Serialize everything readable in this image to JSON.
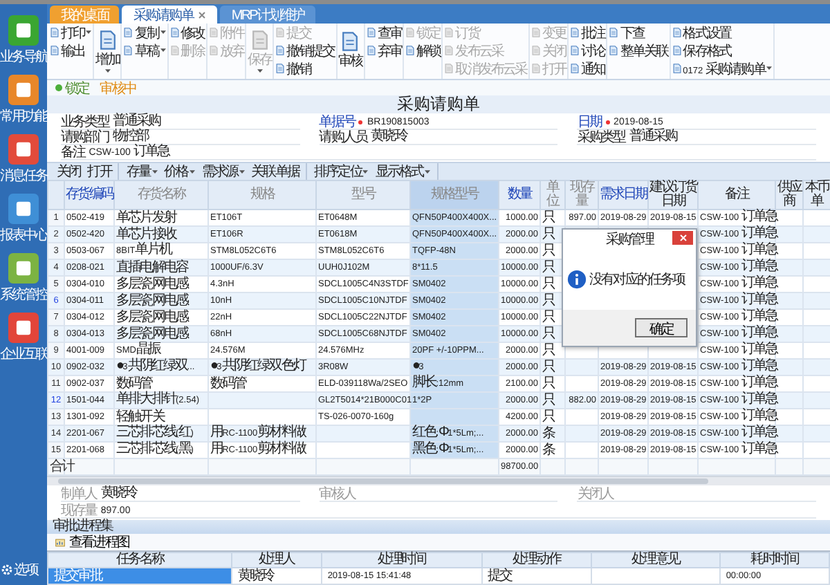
{
  "sidebar": {
    "items": [
      {
        "label": "业务导航",
        "color": "#3aa632"
      },
      {
        "label": "常用功能",
        "color": "#e8872a"
      },
      {
        "label": "消息任务",
        "color": "#e24b3b"
      },
      {
        "label": "报表中心",
        "color": "#3f8fd6"
      },
      {
        "label": "系统管控",
        "color": "#7cb342"
      },
      {
        "label": "企业互联",
        "color": "#e2453a"
      }
    ],
    "options": "选项"
  },
  "tabs": [
    {
      "label": "我的桌面",
      "selected": false,
      "kind": "home",
      "closable": false
    },
    {
      "label": "采购请购单",
      "selected": true,
      "kind": "doc",
      "closable": true
    },
    {
      "label": "MRP计划维护",
      "selected": false,
      "kind": "doc",
      "closable": false
    }
  ],
  "ribbon": [
    {
      "items": [
        {
          "label": "打印",
          "kind": "small",
          "dropdown": true,
          "disabled": false
        },
        {
          "label": "输出",
          "kind": "small",
          "dropdown": false,
          "disabled": false
        }
      ]
    },
    {
      "items": [
        {
          "label": "增加",
          "kind": "large",
          "dropdown": true,
          "disabled": false
        }
      ]
    },
    {
      "items": [
        {
          "label": "复制",
          "kind": "small",
          "dropdown": true,
          "disabled": false
        },
        {
          "label": "草稿",
          "kind": "small",
          "dropdown": true,
          "disabled": false
        }
      ]
    },
    {
      "items": [
        {
          "label": "修改",
          "kind": "small",
          "dropdown": false,
          "disabled": false
        },
        {
          "label": "删除",
          "kind": "small",
          "dropdown": false,
          "disabled": true
        }
      ]
    },
    {
      "items": [
        {
          "label": "附件",
          "kind": "small",
          "dropdown": false,
          "disabled": true
        },
        {
          "label": "放弃",
          "kind": "small",
          "dropdown": false,
          "disabled": true
        }
      ]
    },
    {
      "items": [
        {
          "label": "保存",
          "kind": "large",
          "dropdown": true,
          "disabled": true
        }
      ]
    },
    {
      "items": [
        {
          "label": "提交",
          "kind": "small",
          "dropdown": false,
          "disabled": true
        },
        {
          "label": "撤销提交",
          "kind": "small",
          "dropdown": false,
          "disabled": false
        },
        {
          "label": "撤销",
          "kind": "small",
          "dropdown": false,
          "disabled": false
        }
      ]
    },
    {
      "items": [
        {
          "label": "审核",
          "kind": "large",
          "dropdown": false,
          "disabled": false
        }
      ]
    },
    {
      "items": [
        {
          "label": "查审",
          "kind": "small",
          "dropdown": false,
          "disabled": false
        },
        {
          "label": "弃审",
          "kind": "small",
          "dropdown": false,
          "disabled": false
        }
      ]
    },
    {
      "items": [
        {
          "label": "锁定",
          "kind": "small",
          "dropdown": false,
          "disabled": true
        },
        {
          "label": "解锁",
          "kind": "small",
          "dropdown": false,
          "disabled": false
        }
      ]
    },
    {
      "items": [
        {
          "label": "订货",
          "kind": "small",
          "dropdown": false,
          "disabled": true
        },
        {
          "label": "发布云采",
          "kind": "small",
          "dropdown": false,
          "disabled": true
        },
        {
          "label": "取消发布云采",
          "kind": "small",
          "dropdown": false,
          "disabled": true
        }
      ]
    },
    {
      "items": [
        {
          "label": "变更",
          "kind": "small",
          "dropdown": false,
          "disabled": true
        },
        {
          "label": "关闭",
          "kind": "small",
          "dropdown": false,
          "disabled": true
        },
        {
          "label": "打开",
          "kind": "small",
          "dropdown": false,
          "disabled": true
        }
      ]
    },
    {
      "items": [
        {
          "label": "批注",
          "kind": "small",
          "dropdown": false,
          "disabled": false
        },
        {
          "label": "讨论",
          "kind": "small",
          "dropdown": false,
          "disabled": false
        },
        {
          "label": "通知",
          "kind": "small",
          "dropdown": false,
          "disabled": false
        }
      ]
    },
    {
      "items": [
        {
          "label": "下查",
          "kind": "small",
          "dropdown": false,
          "disabled": false
        },
        {
          "label": "整单关联",
          "kind": "small",
          "dropdown": false,
          "disabled": false
        }
      ]
    },
    {
      "items": [
        {
          "label": "格式设置",
          "kind": "small",
          "dropdown": false,
          "disabled": false
        },
        {
          "label": "保存格式",
          "kind": "small",
          "dropdown": false,
          "disabled": false
        },
        {
          "label": "0172 采购请购单",
          "kind": "small",
          "dropdown": true,
          "disabled": false
        }
      ]
    }
  ],
  "status": {
    "lock": "锁定",
    "state": "审核中"
  },
  "title": "采购请购单",
  "form": [
    [
      {
        "label": "业务类型",
        "value": "普通采购",
        "required": false
      },
      {
        "label": "单据号",
        "value": "BR190815003",
        "required": true
      },
      {
        "label": "日期",
        "value": "2019-08-15",
        "required": true
      }
    ],
    [
      {
        "label": "请购部门",
        "value": "物控部",
        "required": false
      },
      {
        "label": "请购人员",
        "value": "黄晓玲",
        "required": false
      },
      {
        "label": "采购类型",
        "value": "普通采购",
        "required": false
      }
    ],
    [
      {
        "label": "备注",
        "value": "CSW-100 订单急",
        "required": false
      }
    ]
  ],
  "toolbar": [
    [
      {
        "label": "关闭",
        "dropdown": false
      },
      {
        "label": "打开",
        "dropdown": false
      }
    ],
    [
      {
        "label": "存量",
        "dropdown": true
      },
      {
        "label": "价格",
        "dropdown": true
      },
      {
        "label": "需求源",
        "dropdown": true
      },
      {
        "label": "关联单据",
        "dropdown": false
      }
    ],
    [
      {
        "label": "排序定位",
        "dropdown": true
      },
      {
        "label": "显示格式",
        "dropdown": true
      }
    ]
  ],
  "table": {
    "columns": [
      {
        "label": "存货编码",
        "required": true,
        "disabled": false,
        "selected": false
      },
      {
        "label": "存货名称",
        "required": false,
        "disabled": true,
        "selected": false
      },
      {
        "label": "规格",
        "required": false,
        "disabled": true,
        "selected": false
      },
      {
        "label": "型号",
        "required": false,
        "disabled": true,
        "selected": false
      },
      {
        "label": "规格型号",
        "required": false,
        "disabled": true,
        "selected": true
      },
      {
        "label": "数量",
        "required": true,
        "disabled": false,
        "selected": false
      },
      {
        "label": "单位",
        "required": false,
        "disabled": true,
        "selected": false
      },
      {
        "label": "现存量",
        "required": false,
        "disabled": true,
        "selected": false
      },
      {
        "label": "需求日期",
        "required": true,
        "disabled": false,
        "selected": false
      },
      {
        "label": "建议订货日期",
        "required": false,
        "disabled": false,
        "selected": false
      },
      {
        "label": "备注",
        "required": false,
        "disabled": false,
        "selected": false
      },
      {
        "label": "供应商",
        "required": false,
        "disabled": false,
        "selected": false
      },
      {
        "label": "本币单",
        "required": false,
        "disabled": false,
        "selected": false
      }
    ],
    "rows": [
      {
        "number": "1",
        "flagged": false,
        "cells": [
          "0502-419",
          "单芯片发射",
          "ET106T",
          "ET0648M",
          "QFN50P400X400X...",
          "1000.00",
          "只",
          "897.00",
          "2019-08-29",
          "2019-08-15",
          "CSW-100 订单急",
          null,
          null
        ]
      },
      {
        "number": "2",
        "flagged": false,
        "cells": [
          "0502-420",
          "单芯片接收",
          "ET106R",
          "ET0618M",
          "QFN50P400X400X...",
          "2000.00",
          "只",
          null,
          null,
          null,
          "CSW-100 订单急",
          null,
          null
        ]
      },
      {
        "number": "3",
        "flagged": false,
        "cells": [
          "0503-067",
          "8BIT单片机",
          "STM8L052C6T6",
          "STM8L052C6T6",
          "TQFP-48N",
          "2000.00",
          "只",
          null,
          null,
          null,
          "CSW-100 订单急",
          null,
          null
        ]
      },
      {
        "number": "4",
        "flagged": false,
        "cells": [
          "0208-021",
          "直插电解电容",
          "1000UF/6.3V",
          "UUH0J102M",
          "8*11.5",
          "10000.00",
          "只",
          null,
          null,
          null,
          "CSW-100 订单急",
          null,
          null
        ]
      },
      {
        "number": "5",
        "flagged": false,
        "cells": [
          "0304-010",
          "多层瓷网电感",
          "4.3nH",
          "SDCL1005C4N3STDF",
          "SM0402",
          "10000.00",
          "只",
          null,
          null,
          null,
          "CSW-100 订单急",
          null,
          null
        ]
      },
      {
        "number": "6",
        "flagged": true,
        "cells": [
          "0304-011",
          "多层瓷网电感",
          "10nH",
          "SDCL1005C10NJTDF",
          "SM0402",
          "10000.00",
          "只",
          null,
          null,
          null,
          "CSW-100 订单急",
          null,
          null
        ]
      },
      {
        "number": "7",
        "flagged": false,
        "cells": [
          "0304-012",
          "多层瓷网电感",
          "22nH",
          "SDCL1005C22NJTDF",
          "SM0402",
          "10000.00",
          "只",
          null,
          null,
          null,
          "CSW-100 订单急",
          null,
          null
        ]
      },
      {
        "number": "8",
        "flagged": false,
        "cells": [
          "0304-013",
          "多层瓷网电感",
          "68nH",
          "SDCL1005C68NJTDF",
          "SM0402",
          "10000.00",
          "只",
          null,
          null,
          null,
          "CSW-100 订单急",
          null,
          null
        ]
      },
      {
        "number": "9",
        "flagged": false,
        "cells": [
          "4001-009",
          "SMD晶振",
          "24.576M",
          "24.576MHz",
          "20PF +/-10PPM...",
          "2000.00",
          "只",
          null,
          null,
          null,
          "CSW-100 订单急",
          null,
          null
        ]
      },
      {
        "number": "10",
        "flagged": false,
        "cells": [
          "0902-032",
          "●3共阴红绿双...",
          "●3共阴红绿双色灯",
          "3R08W",
          "●3",
          "2000.00",
          "只",
          null,
          "2019-08-29",
          "2019-08-15",
          "CSW-100 订单急",
          null,
          null
        ]
      },
      {
        "number": "11",
        "flagged": false,
        "cells": [
          "0902-037",
          "数码管",
          "数码管",
          "ELD-039118Wa/2SEO",
          "脚长:12mm",
          "2100.00",
          "只",
          null,
          "2019-08-29",
          "2019-08-15",
          "CSW-100 订单急",
          null,
          null
        ]
      },
      {
        "number": "12",
        "flagged": true,
        "cells": [
          "1501-044",
          "单排大排针(2.54)",
          null,
          "GL2T5014*21B000C01",
          "1*2P",
          "2000.00",
          "只",
          "882.00",
          "2019-08-29",
          "2019-08-15",
          "CSW-100 订单急",
          null,
          null
        ]
      },
      {
        "number": "13",
        "flagged": false,
        "cells": [
          "1301-092",
          "轻触开关",
          null,
          "TS-026-0070-160g",
          null,
          "4200.00",
          "只",
          null,
          "2019-08-29",
          "2019-08-15",
          "CSW-100 订单急",
          null,
          null
        ]
      },
      {
        "number": "14",
        "flagged": false,
        "cells": [
          "2201-067",
          "三芯排芯线(红)",
          "用RC-1100剪材料做",
          null,
          "红色:Φ1*5Lm;...",
          "2000.00",
          "条",
          null,
          "2019-08-29",
          "2019-08-15",
          "CSW-100 订单急",
          null,
          null
        ]
      },
      {
        "number": "15",
        "flagged": false,
        "cells": [
          "2201-068",
          "三芯排芯线(黑)",
          "用RC-1100剪材料做",
          null,
          "黑色:Φ1*5Lm;...",
          "2000.00",
          "条",
          null,
          "2019-08-29",
          "2019-08-15",
          "CSW-100 订单急",
          null,
          null
        ]
      }
    ],
    "total": {
      "label": "合计",
      "quantity": "98700.00"
    }
  },
  "dialog": {
    "title": "采购管理",
    "message": "没有对应的任务项",
    "button": "确定"
  },
  "footer": [
    [
      {
        "label": "制单人",
        "value": "黄晓玲"
      },
      {
        "label": "审核人"
      },
      {
        "label": "关闭人"
      }
    ],
    [
      {
        "label": "现存量",
        "value": "897.00"
      }
    ]
  ],
  "approval": {
    "title": "审批进程集",
    "button": "查看进程图",
    "columns": [
      "任务名称",
      "处理人",
      "处理时间",
      "处理动作",
      "处理意见",
      "耗时时间"
    ],
    "rows": [
      {
        "selected": true,
        "cells": [
          "提交审批",
          "黄晓玲",
          "2019-08-15 15:41:48",
          "提交",
          null,
          "00:00:00"
        ]
      }
    ]
  }
}
